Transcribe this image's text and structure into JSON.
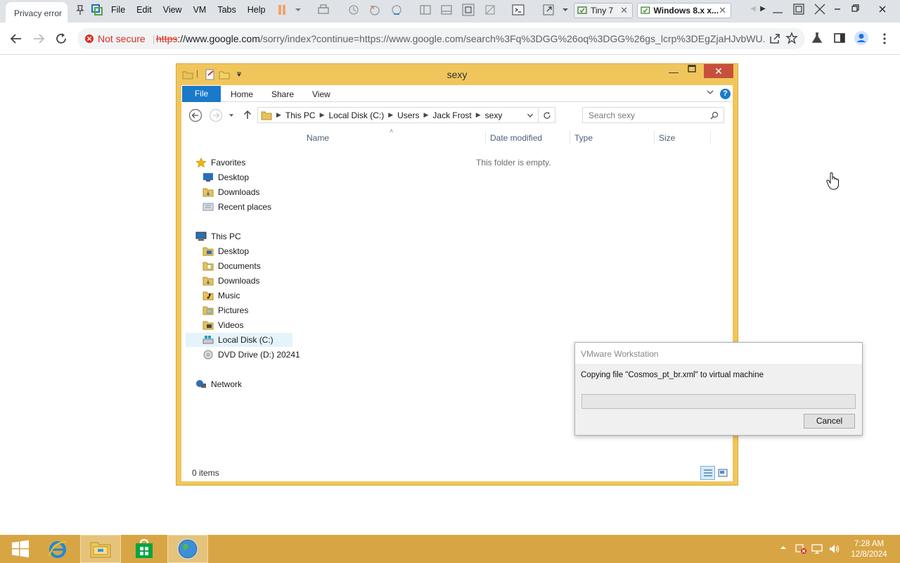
{
  "browser": {
    "tab_title": "Privacy error",
    "security_label": "Not secure",
    "url_scheme": "https",
    "url_host": "://www.google.com",
    "url_rest": "/sorry/index?continue=https://www.google.com/search%3Fq%3DGG%26oq%3DGG%26gs_lcrp%3DEgZjaHJvbWU..."
  },
  "vmware": {
    "menu": [
      "File",
      "Edit",
      "View",
      "VM",
      "Tabs",
      "Help"
    ],
    "tabs": [
      {
        "label": "Tiny 7"
      },
      {
        "label": "Windows 8.x x..."
      }
    ]
  },
  "explorer": {
    "title": "sexy",
    "ribbon_tabs": [
      "File",
      "Home",
      "Share",
      "View"
    ],
    "breadcrumb": [
      "This PC",
      "Local Disk (C:)",
      "Users",
      "Jack Frost",
      "sexy"
    ],
    "search_placeholder": "Search sexy",
    "nav": {
      "favorites": "Favorites",
      "fav_items": [
        "Desktop",
        "Downloads",
        "Recent places"
      ],
      "this_pc": "This PC",
      "pc_items": [
        "Desktop",
        "Documents",
        "Downloads",
        "Music",
        "Pictures",
        "Videos",
        "Local Disk (C:)",
        "DVD Drive (D:) 20241"
      ],
      "network": "Network"
    },
    "columns": [
      "Name",
      "Date modified",
      "Type",
      "Size"
    ],
    "empty_message": "This folder is empty.",
    "status": "0 items"
  },
  "dialog": {
    "title": "VMware Workstation",
    "message": "Copying file \"Cosmos_pt_br.xml\" to virtual machine",
    "progress": 0,
    "cancel_label": "Cancel"
  },
  "taskbar": {
    "time": "7:28 AM",
    "date": "12/8/2024"
  },
  "colors": {
    "explorer_frame": "#f0c65c",
    "taskbar": "#d8a545",
    "file_tab": "#1979ca",
    "not_secure": "#d93025"
  }
}
